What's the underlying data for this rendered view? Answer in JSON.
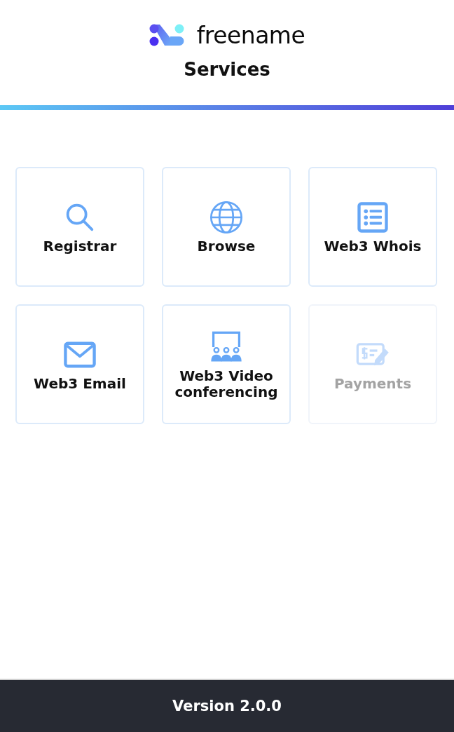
{
  "brand": "freename",
  "title": "Services",
  "services": [
    {
      "label": "Registrar",
      "disabled": false
    },
    {
      "label": "Browse",
      "disabled": false
    },
    {
      "label": "Web3 Whois",
      "disabled": false
    },
    {
      "label": "Web3 Email",
      "disabled": false
    },
    {
      "label": "Web3 Video conferencing",
      "disabled": false
    },
    {
      "label": "Payments",
      "disabled": true
    }
  ],
  "footer": "Version 2.0.0"
}
